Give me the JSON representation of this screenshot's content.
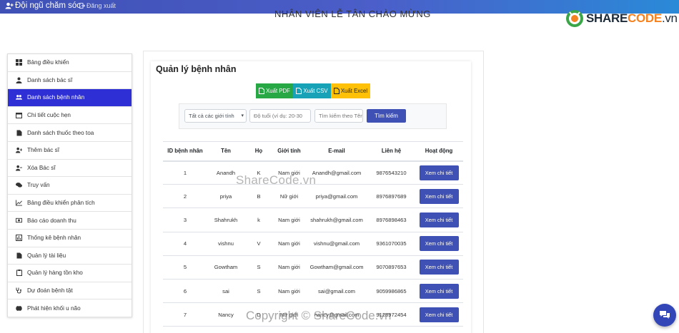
{
  "topbar": {
    "brand": "Đội ngũ chăm sóc",
    "logout": "Đăng xuất",
    "page_heading": "NHÂN VIÊN LỄ TÂN CHÀO MỪNG"
  },
  "logo": {
    "text_main": "SHARE",
    "text_code": "CODE",
    "text_tld": ".vn"
  },
  "sidebar": {
    "items": [
      {
        "label": "Bảng điều khiển",
        "icon": "grid-icon"
      },
      {
        "label": "Danh sách bác sĩ",
        "icon": "user-md-icon"
      },
      {
        "label": "Danh sách bệnh nhân",
        "icon": "users-icon",
        "active": true
      },
      {
        "label": "Chi tiết cuộc hẹn",
        "icon": "calendar-icon"
      },
      {
        "label": "Danh sách thuốc theo toa",
        "icon": "file-icon"
      },
      {
        "label": "Thêm bác sĩ",
        "icon": "user-plus-icon"
      },
      {
        "label": "Xóa Bác sĩ",
        "icon": "user-minus-icon"
      },
      {
        "label": "Truy vấn",
        "icon": "comments-icon"
      },
      {
        "label": "Bảng điều khiển phân tích",
        "icon": "chart-line-icon"
      },
      {
        "label": "Báo cáo doanh thu",
        "icon": "money-icon"
      },
      {
        "label": "Thống kê bệnh nhân",
        "icon": "bar-chart-icon"
      },
      {
        "label": "Quản lý tài liệu",
        "icon": "document-icon"
      },
      {
        "label": "Quản lý hàng tồn kho",
        "icon": "clipboard-icon"
      },
      {
        "label": "Dự đoán bệnh tật",
        "icon": "stethoscope-icon"
      },
      {
        "label": "Phát hiện khối u não",
        "icon": "brain-icon"
      }
    ]
  },
  "main": {
    "title": "Quản lý bệnh nhân",
    "export": {
      "pdf": "Xuất PDF",
      "csv": "Xuất CSV",
      "excel": "Xuất Excel"
    },
    "filter": {
      "gender_selected": "Tất cả các giới tính",
      "age_placeholder": "Độ tuổi (ví dụ: 20-30",
      "search_placeholder": "Tìm kiếm theo Tên",
      "search_button": "Tìm kiếm"
    },
    "table": {
      "headers": [
        "ID bệnh nhân",
        "Tên",
        "Họ",
        "Giới tính",
        "E-mail",
        "Liên hệ",
        "Hoạt động"
      ],
      "action_label": "Xem chi tiết",
      "rows": [
        [
          "1",
          "Anandh",
          "K",
          "Nam giới",
          "Anandh@gmail.com",
          "9876543210"
        ],
        [
          "2",
          "priya",
          "B",
          "Nữ giới",
          "priya@gmail.com",
          "8976897689"
        ],
        [
          "3",
          "Shahrukh",
          "k",
          "Nam giới",
          "shahrukh@gmail.com",
          "8976898463"
        ],
        [
          "4",
          "vishnu",
          "V",
          "Nam giới",
          "vishnu@gmail.com",
          "9361070035"
        ],
        [
          "5",
          "Gowtham",
          "S",
          "Nam giới",
          "Gowtham@gmail.com",
          "9070897653"
        ],
        [
          "6",
          "sai",
          "S",
          "Nam giới",
          "sai@gmail.com",
          "9059986865"
        ],
        [
          "7",
          "Nancy",
          "D",
          "Nữ giới",
          "nancy@gmail.com",
          "9128972454"
        ]
      ]
    }
  },
  "watermark": {
    "center": "ShareCode.vn",
    "bottom": "Copyright © ShareCode.vn"
  },
  "colors": {
    "primary": "#3f51b5",
    "active_sidebar": "#2f2fd6",
    "pdf": "#28a745",
    "csv": "#17a2b8",
    "excel": "#ffc107"
  }
}
